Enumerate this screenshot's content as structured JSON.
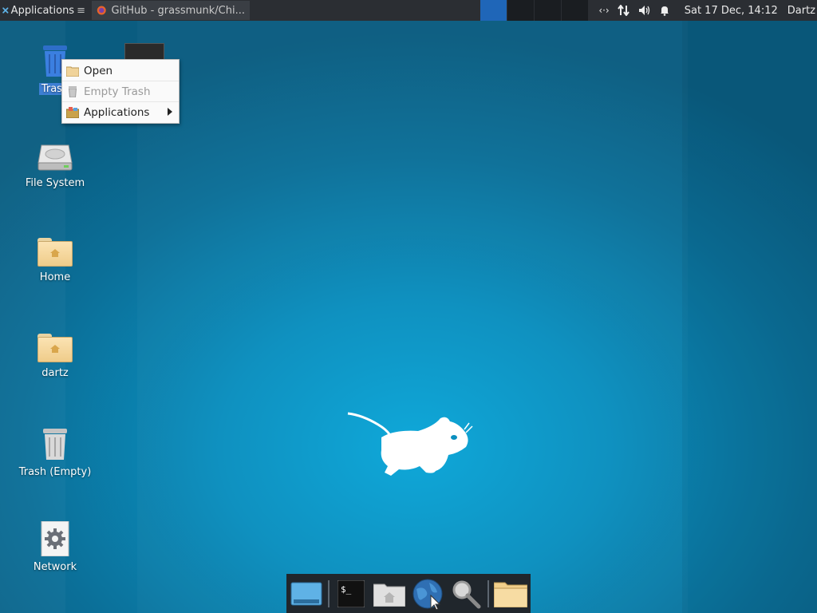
{
  "top_panel": {
    "applications_label": "Applications",
    "task_title": "GitHub - grassmunk/Chi...",
    "datetime": "Sat 17 Dec, 14:12",
    "user": "Dartz"
  },
  "desktop_icons": [
    {
      "label": "Trash"
    },
    {
      "label": "File System"
    },
    {
      "label": "Home"
    },
    {
      "label": "dartz"
    },
    {
      "label": "Trash (Empty)"
    },
    {
      "label": "Network"
    }
  ],
  "context_menu": {
    "items": [
      {
        "label": "Open"
      },
      {
        "label": "Empty Trash"
      },
      {
        "label": "Applications"
      }
    ]
  },
  "colors": {
    "panel": "#2b2e33",
    "desktop": "#0a8fbf",
    "dock": "#20262c"
  }
}
